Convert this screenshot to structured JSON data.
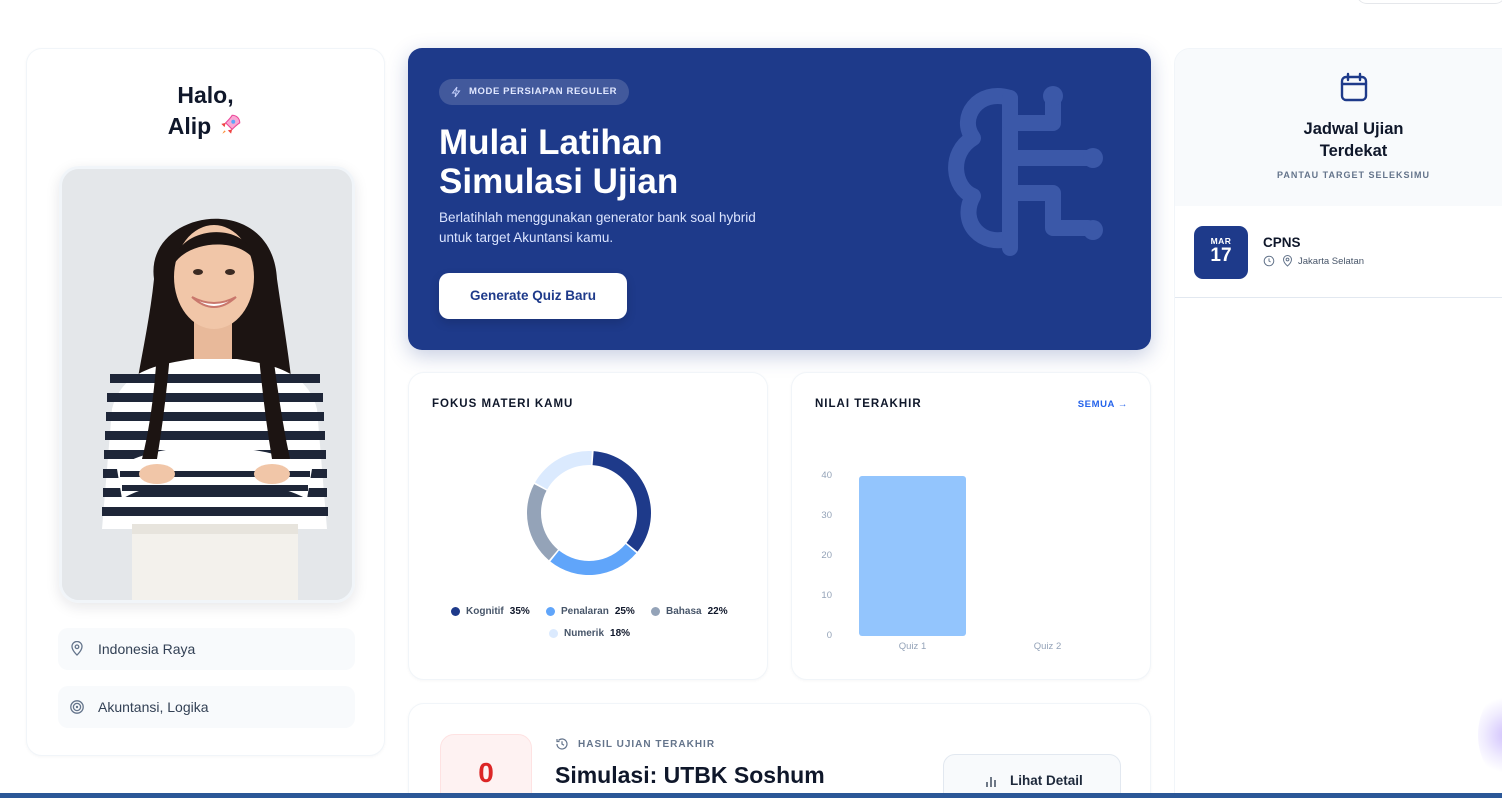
{
  "profile": {
    "greeting": "Halo,",
    "name": "Alip",
    "location": "Indonesia Raya",
    "interests": "Akuntansi, Logika"
  },
  "hero": {
    "mode_label": "MODE PERSIAPAN REGULER",
    "title_line1": "Mulai Latihan",
    "title_line2": "Simulasi Ujian",
    "description_line1": "Berlatihlah menggunakan generator bank soal hybrid",
    "description_line2": "untuk target Akuntansi kamu.",
    "button_label": "Generate Quiz Baru"
  },
  "fokus": {
    "title": "FOKUS MATERI KAMU",
    "items": [
      {
        "label": "Kognitif",
        "pct": "35%",
        "value": 35,
        "color": "#1e3a8a"
      },
      {
        "label": "Penalaran",
        "pct": "25%",
        "value": 25,
        "color": "#60a5fa"
      },
      {
        "label": "Bahasa",
        "pct": "22%",
        "value": 22,
        "color": "#94a3b8"
      },
      {
        "label": "Numerik",
        "pct": "18%",
        "value": 18,
        "color": "#dbeafe"
      }
    ]
  },
  "nilai": {
    "title": "NILAI TERAKHIR",
    "link_label": "SEMUA →"
  },
  "chart_data": {
    "type": "bar",
    "categories": [
      "Quiz 1",
      "Quiz 2"
    ],
    "values": [
      40,
      0
    ],
    "title": "",
    "xlabel": "",
    "ylabel": "",
    "ylim": [
      0,
      40
    ],
    "yticks": [
      0,
      10,
      20,
      30,
      40
    ],
    "color": "#93c5fd"
  },
  "result": {
    "score": "0",
    "label": "HASIL UJIAN TERAKHIR",
    "title": "Simulasi: UTBK Soshum",
    "button_label": "Lihat Detail"
  },
  "schedule": {
    "title_line1": "Jadwal Ujian",
    "title_line2": "Terdekat",
    "subtitle": "PANTAU TARGET SELEKSIMU",
    "events": [
      {
        "month": "MAR",
        "day": "17",
        "name": "CPNS",
        "location": "Jakarta Selatan"
      }
    ]
  },
  "icons": {
    "mode": "lightning-icon",
    "location": "map-pin-icon",
    "interest": "target-icon",
    "calendar": "calendar-icon",
    "history": "history-icon",
    "detail": "bar-chart-icon"
  }
}
